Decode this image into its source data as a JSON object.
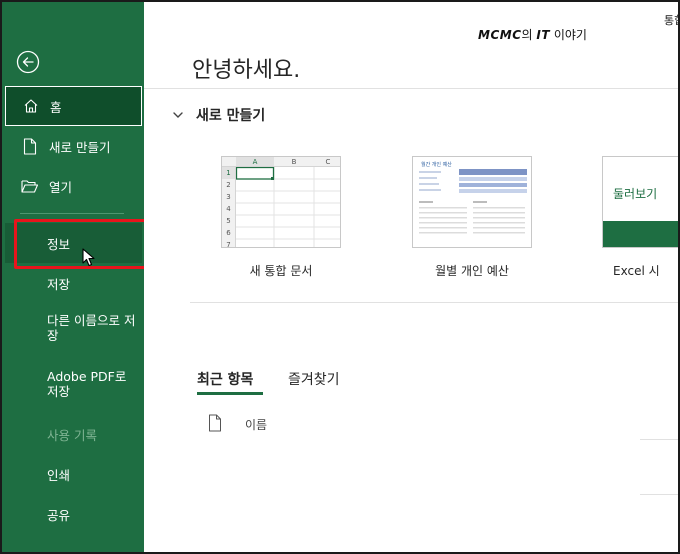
{
  "sidebar": {
    "items": [
      {
        "label": "홈"
      },
      {
        "label": "새로 만들기"
      },
      {
        "label": "열기"
      },
      {
        "label": "정보"
      },
      {
        "label": "저장"
      },
      {
        "label": "다른 이름으로 저장"
      },
      {
        "label": "Adobe PDF로 저장"
      },
      {
        "label": "사용 기록"
      },
      {
        "label": "인쇄"
      },
      {
        "label": "공유"
      }
    ]
  },
  "header": {
    "blog_brand": "MCMC",
    "blog_mid": "의 ",
    "blog_it": "IT",
    "blog_suffix": " 이야기",
    "top_right": "통합"
  },
  "main": {
    "greeting": "안녕하세요.",
    "new_section": "새로 만들기",
    "templates": [
      {
        "caption": "새 통합 문서",
        "cols": [
          "A",
          "B",
          "C"
        ],
        "rows": [
          "1",
          "2",
          "3",
          "4",
          "5",
          "6",
          "7"
        ]
      },
      {
        "caption": "월별 개인 예산",
        "thumb_title": "월간 개인 예산"
      },
      {
        "caption": "Excel 시",
        "thumb_label": "둘러보기"
      }
    ],
    "tabs": [
      {
        "label": "최근 항목"
      },
      {
        "label": "즐겨찾기"
      }
    ],
    "column_name": "이름"
  },
  "colors": {
    "sidebar_bg": "#1e6e42",
    "sidebar_active": "#0f4e2b",
    "highlight": "#e8141c"
  }
}
